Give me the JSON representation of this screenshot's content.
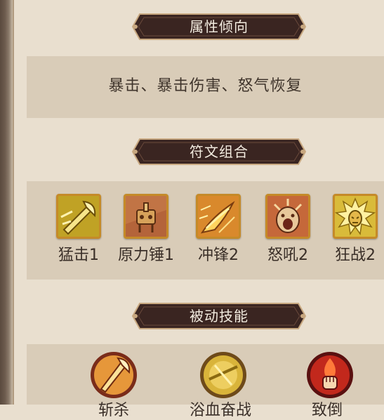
{
  "sections": {
    "attributes": {
      "title": "属性倾向",
      "text": "暴击、暴击伤害、怒气恢复"
    },
    "runes": {
      "title": "符文组合",
      "items": [
        {
          "label": "猛击1",
          "icon": "axe-strike-icon"
        },
        {
          "label": "原力锤1",
          "icon": "force-hammer-icon"
        },
        {
          "label": "冲锋2",
          "icon": "charge-icon"
        },
        {
          "label": "怒吼2",
          "icon": "roar-icon"
        },
        {
          "label": "狂战2",
          "icon": "berserk-icon"
        }
      ]
    },
    "passives": {
      "title": "被动技能",
      "items": [
        {
          "label": "斩杀",
          "icon": "execute-icon"
        },
        {
          "label": "浴血奋战",
          "icon": "bloodbath-icon"
        },
        {
          "label": "致倒",
          "icon": "fist-icon"
        }
      ]
    }
  },
  "colors": {
    "background": "#e9dfcf",
    "content_box": "#d9ccb8",
    "banner": "#3a2521",
    "banner_border": "#c8a880",
    "gold_frame": "#c58a28"
  }
}
